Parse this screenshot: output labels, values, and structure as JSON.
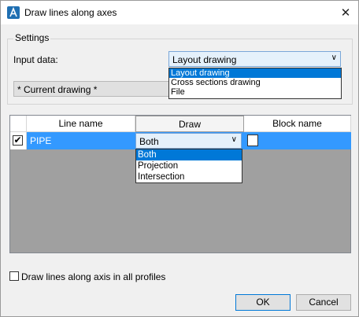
{
  "window": {
    "title": "Draw lines along axes",
    "close": "✕"
  },
  "settings": {
    "group_label": "Settings",
    "input_label": "Input data:",
    "input_value": "Layout drawing",
    "input_options": [
      "Layout drawing",
      "Cross sections drawing",
      "File"
    ],
    "current_drawing": "* Current drawing *"
  },
  "grid": {
    "columns": [
      "Line name",
      "Draw",
      "Block name"
    ],
    "row": {
      "checked": "✔",
      "line_name": "PIPE",
      "draw": "Both"
    },
    "draw_options": [
      "Both",
      "Projection",
      "Intersection"
    ]
  },
  "footer": {
    "checkbox_label": "Draw lines along axis in all profiles",
    "ok": "OK",
    "cancel": "Cancel"
  }
}
